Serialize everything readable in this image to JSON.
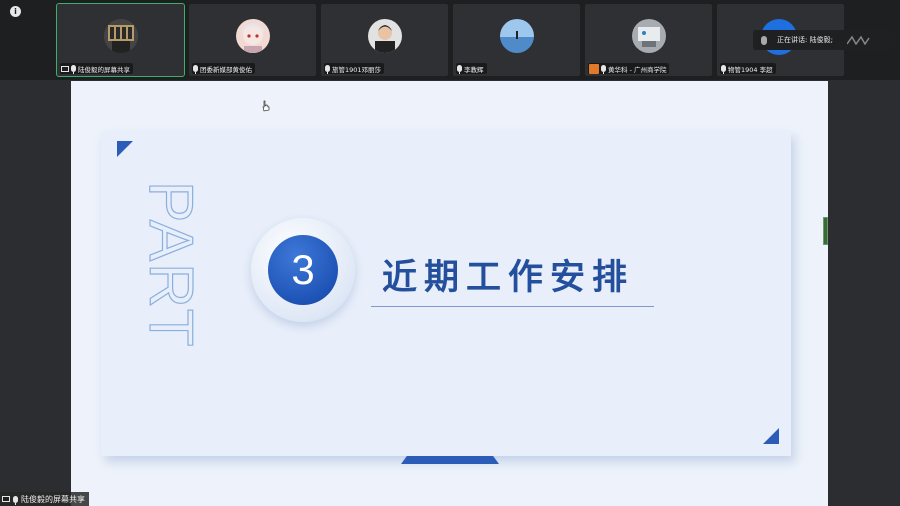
{
  "participants": [
    {
      "name": "陆俊毅的屏幕共享",
      "icon": "screen-share-icon",
      "active": true,
      "avatar_color": "#3b3b3b"
    },
    {
      "name": "团委新媒部黄俊佑",
      "icon": "mic-icon",
      "active": false,
      "avatar_color": "#e9b7b0"
    },
    {
      "name": "旅管1901邓丽莎",
      "icon": "mic-icon",
      "active": false,
      "avatar_color": "#d6d6d6"
    },
    {
      "name": "李教辉",
      "icon": "mic-icon",
      "active": false,
      "avatar_color": "#6aa7d8"
    },
    {
      "name": "黄华科 - 广州商学院",
      "icon": "mic-icon",
      "active": false,
      "avatar_color": "#8d949a"
    },
    {
      "name": "物管1904 李超",
      "icon": "mic-icon",
      "active": false,
      "avatar_color": "#1f6fe0"
    }
  ],
  "speaking": {
    "text": "正在讲话: 陆俊毅;"
  },
  "slide": {
    "part_text": "PART",
    "number": "3",
    "title": "近期工作安排"
  },
  "share_badge": {
    "text": "陆俊毅的屏幕共享"
  },
  "colors": {
    "accent": "#2a5cb8",
    "title": "#234f9c",
    "stage_bg": "#eef3fb",
    "topbar_bg": "#1e1f21"
  }
}
